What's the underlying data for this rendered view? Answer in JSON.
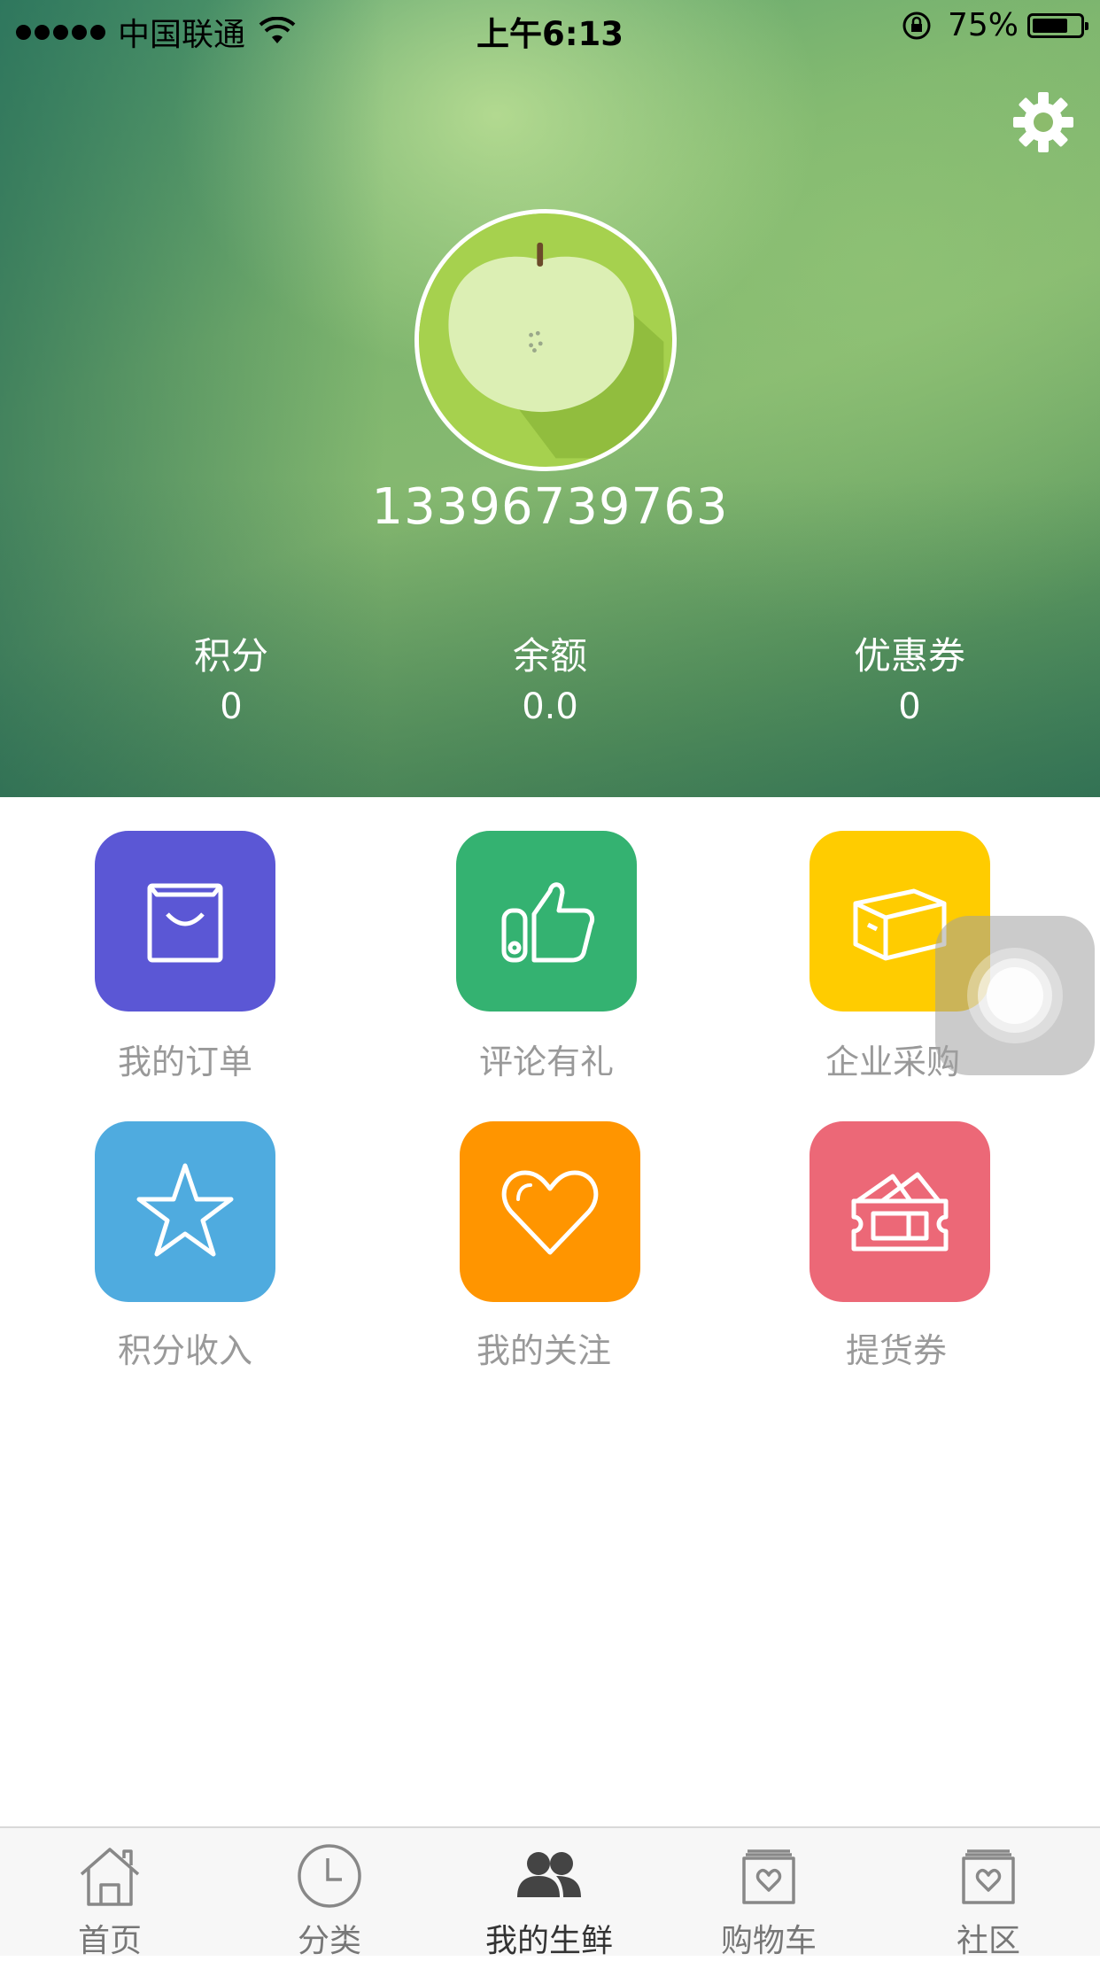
{
  "status_bar": {
    "carrier": "中国联通",
    "time": "上午6:13",
    "battery_percent": "75%",
    "battery_level": 0.75
  },
  "profile": {
    "phone": "13396739763",
    "stats": [
      {
        "label": "积分",
        "value": "0"
      },
      {
        "label": "余额",
        "value": "0.0"
      },
      {
        "label": "优惠券",
        "value": "0"
      }
    ]
  },
  "menu": [
    {
      "label": "我的订单",
      "icon": "shopping-bag-icon",
      "color": "#5b57d5"
    },
    {
      "label": "评论有礼",
      "icon": "thumbs-up-icon",
      "color": "#34b271"
    },
    {
      "label": "企业采购",
      "icon": "box-icon",
      "color": "#ffcc00"
    },
    {
      "label": "积分收入",
      "icon": "star-icon",
      "color": "#4fabdf"
    },
    {
      "label": "我的关注",
      "icon": "heart-icon",
      "color": "#ff9500"
    },
    {
      "label": "提货券",
      "icon": "ticket-icon",
      "color": "#ec6877"
    }
  ],
  "tabbar": {
    "tabs": [
      {
        "label": "首页",
        "icon": "home-icon"
      },
      {
        "label": "分类",
        "icon": "clock-icon"
      },
      {
        "label": "我的生鲜",
        "icon": "users-icon"
      },
      {
        "label": "购物车",
        "icon": "cart-icon"
      },
      {
        "label": "社区",
        "icon": "community-icon"
      }
    ],
    "active": "我的生鲜"
  }
}
